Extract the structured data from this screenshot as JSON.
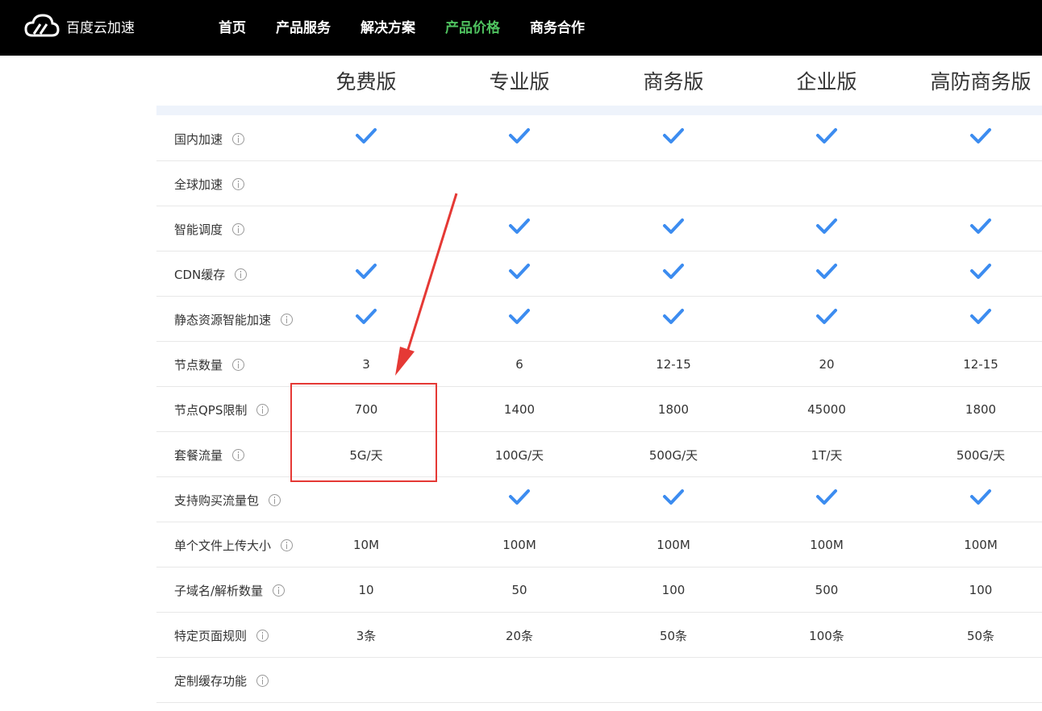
{
  "header": {
    "brand": "百度云加速",
    "brand_icon": "cloud-icon",
    "nav": [
      {
        "label": "首页",
        "active": false
      },
      {
        "label": "产品服务",
        "active": false
      },
      {
        "label": "解决方案",
        "active": false
      },
      {
        "label": "产品价格",
        "active": true
      },
      {
        "label": "商务合作",
        "active": false
      }
    ]
  },
  "plans": [
    "免费版",
    "专业版",
    "商务版",
    "企业版",
    "高防商务版"
  ],
  "rows": [
    {
      "feature": "国内加速",
      "cells": [
        true,
        true,
        true,
        true,
        true
      ]
    },
    {
      "feature": "全球加速",
      "cells": [
        false,
        false,
        false,
        false,
        false
      ]
    },
    {
      "feature": "智能调度",
      "cells": [
        false,
        true,
        true,
        true,
        true
      ]
    },
    {
      "feature": "CDN缓存",
      "cells": [
        true,
        true,
        true,
        true,
        true
      ]
    },
    {
      "feature": "静态资源智能加速",
      "cells": [
        true,
        true,
        true,
        true,
        true
      ]
    },
    {
      "feature": "节点数量",
      "cells": [
        "3",
        "6",
        "12-15",
        "20",
        "12-15"
      ]
    },
    {
      "feature": "节点QPS限制",
      "cells": [
        "700",
        "1400",
        "1800",
        "45000",
        "1800"
      ]
    },
    {
      "feature": "套餐流量",
      "cells": [
        "5G/天",
        "100G/天",
        "500G/天",
        "1T/天",
        "500G/天"
      ]
    },
    {
      "feature": "支持购买流量包",
      "cells": [
        false,
        true,
        true,
        true,
        true
      ]
    },
    {
      "feature": "单个文件上传大小",
      "cells": [
        "10M",
        "100M",
        "100M",
        "100M",
        "100M"
      ]
    },
    {
      "feature": "子域名/解析数量",
      "cells": [
        "10",
        "50",
        "100",
        "500",
        "100"
      ]
    },
    {
      "feature": "特定页面规则",
      "cells": [
        "3条",
        "20条",
        "50条",
        "100条",
        "50条"
      ]
    },
    {
      "feature": "定制缓存功能",
      "cells": [
        false,
        false,
        false,
        false,
        false
      ]
    }
  ],
  "colors": {
    "check": "#3c8cf0",
    "nav_active": "#4fc25f",
    "annotation": "#e53935"
  }
}
